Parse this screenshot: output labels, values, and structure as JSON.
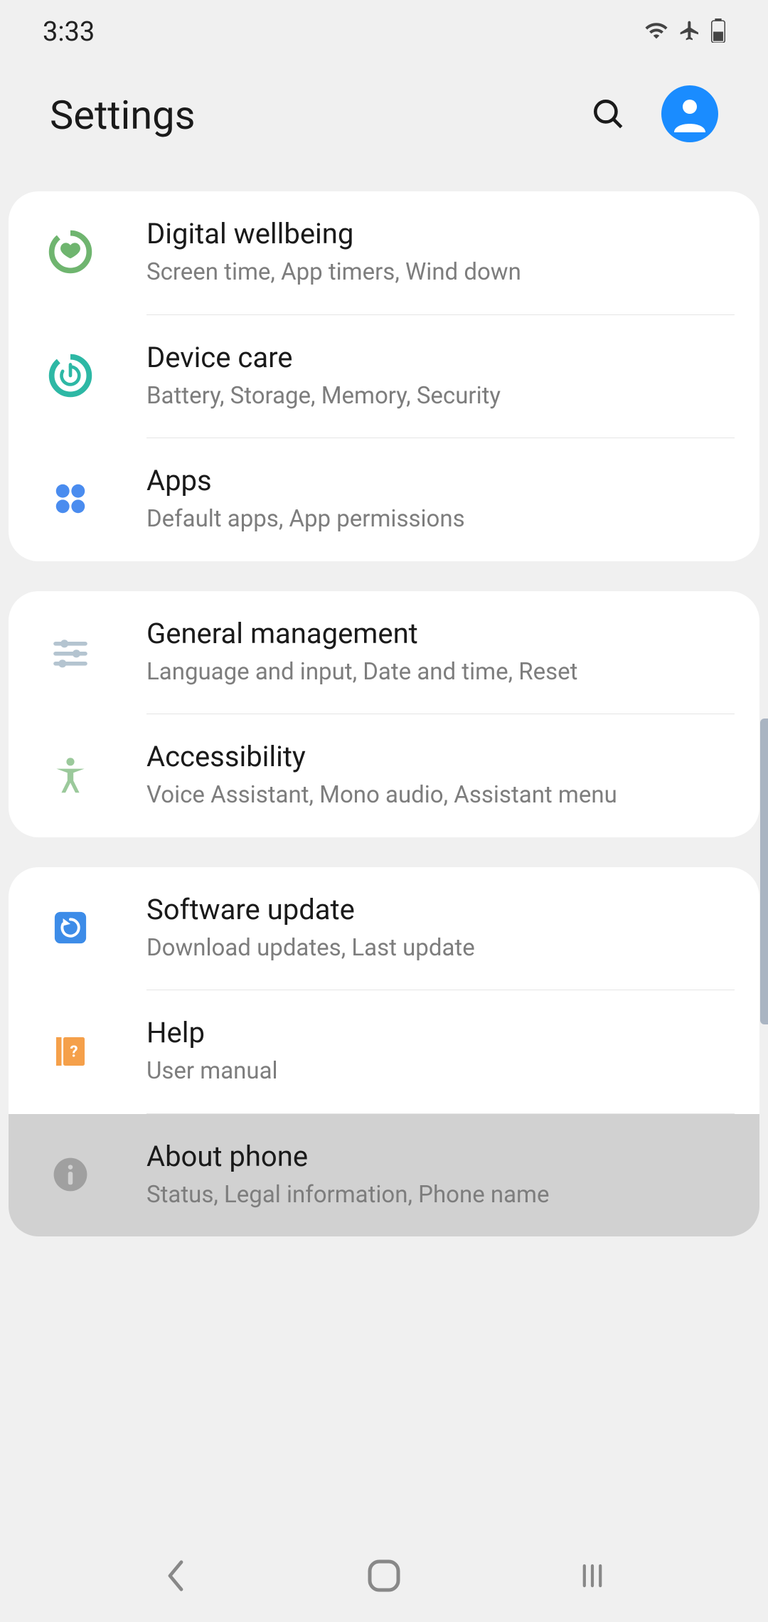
{
  "status": {
    "time": "3:33"
  },
  "header": {
    "title": "Settings"
  },
  "groups": [
    {
      "items": [
        {
          "title": "Digital wellbeing",
          "subtitle": "Screen time, App timers, Wind down",
          "icon": "digital-wellbeing",
          "highlighted": false
        },
        {
          "title": "Device care",
          "subtitle": "Battery, Storage, Memory, Security",
          "icon": "device-care",
          "highlighted": false
        },
        {
          "title": "Apps",
          "subtitle": "Default apps, App permissions",
          "icon": "apps",
          "highlighted": false
        }
      ]
    },
    {
      "items": [
        {
          "title": "General management",
          "subtitle": "Language and input, Date and time, Reset",
          "icon": "general-management",
          "highlighted": false
        },
        {
          "title": "Accessibility",
          "subtitle": "Voice Assistant, Mono audio, Assistant menu",
          "icon": "accessibility",
          "highlighted": false
        }
      ]
    },
    {
      "items": [
        {
          "title": "Software update",
          "subtitle": "Download updates, Last update",
          "icon": "software-update",
          "highlighted": false
        },
        {
          "title": "Help",
          "subtitle": "User manual",
          "icon": "help",
          "highlighted": false
        },
        {
          "title": "About phone",
          "subtitle": "Status, Legal information, Phone name",
          "icon": "about-phone",
          "highlighted": true
        }
      ]
    }
  ]
}
